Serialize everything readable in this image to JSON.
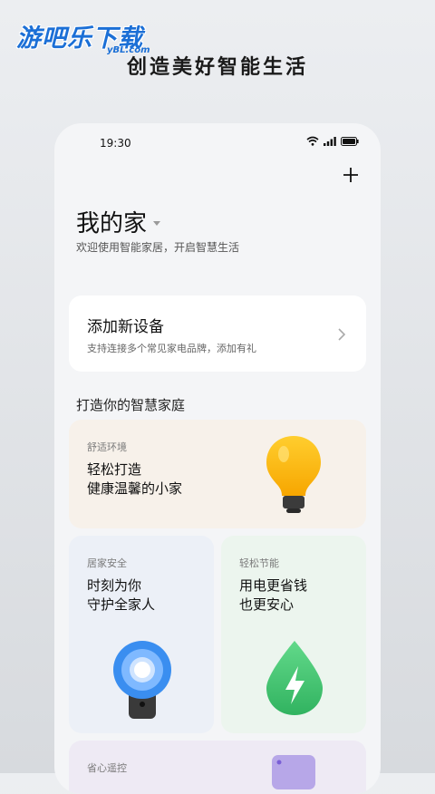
{
  "watermark": {
    "title": "游吧乐下载",
    "subtitle": "yBL.com"
  },
  "tagline": "创造美好智能生活",
  "status_bar": {
    "time": "19:30"
  },
  "header": {
    "title": "我的家",
    "subtitle": "欢迎使用智能家居，开启智慧生活"
  },
  "add_device": {
    "title": "添加新设备",
    "subtitle": "支持连接多个常见家电品牌，添加有礼"
  },
  "section": {
    "title": "打造你的智慧家庭"
  },
  "cards": {
    "comfort": {
      "label": "舒适环境",
      "line1": "轻松打造",
      "line2": "健康温馨的小家"
    },
    "security": {
      "label": "居家安全",
      "line1": "时刻为你",
      "line2": "守护全家人"
    },
    "energy": {
      "label": "轻松节能",
      "line1": "用电更省钱",
      "line2": "也更安心"
    },
    "remote": {
      "label": "省心遥控"
    }
  },
  "icons": {
    "wifi": "wifi-icon",
    "signal": "signal-icon",
    "battery": "battery-icon",
    "add": "plus-icon",
    "dropdown": "triangle-down-icon",
    "chevron": "chevron-right-icon"
  },
  "colors": {
    "bulb": "#f7b500",
    "camera": "#3a8ef0",
    "leaf_drop": "#3fbf6e"
  }
}
